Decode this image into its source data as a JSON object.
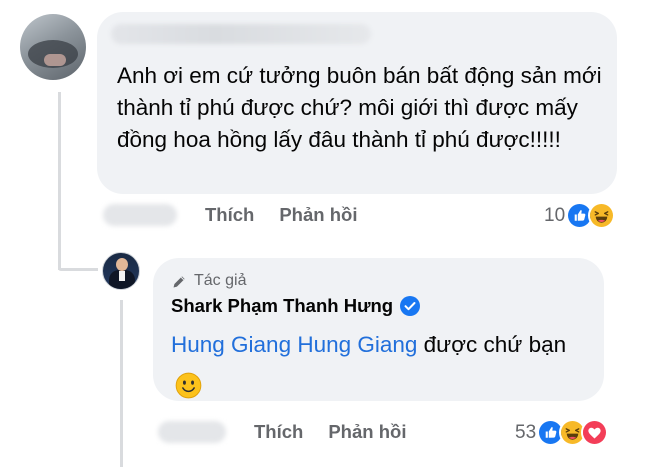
{
  "comment": {
    "text": "Anh ơi em cứ tưởng buôn bán bất động sản mới thành tỉ phú được chứ? môi giới thì được mấy đồng hoa hồng lấy đâu thành tỉ phú được!!!!!",
    "actions": {
      "like_label": "Thích",
      "reply_label": "Phản hồi"
    },
    "reactions": {
      "count": "10",
      "types": [
        "like",
        "haha"
      ]
    }
  },
  "reply": {
    "badge_label": "Tác giả",
    "author_name": "Shark Phạm Thanh Hưng",
    "mention": "Hung Giang Hung Giang",
    "text": " được chứ bạn",
    "emoji": "slightly-smiling-face",
    "actions": {
      "like_label": "Thích",
      "reply_label": "Phản hồi"
    },
    "reactions": {
      "count": "53",
      "types": [
        "like",
        "haha",
        "love"
      ]
    }
  },
  "colors": {
    "bubble": "#f0f2f5",
    "secondary_text": "#65676b",
    "mention": "#216fdb",
    "like_blue": "#1877f2",
    "haha_yellow": "#f7b928",
    "love_red": "#f33e58"
  }
}
